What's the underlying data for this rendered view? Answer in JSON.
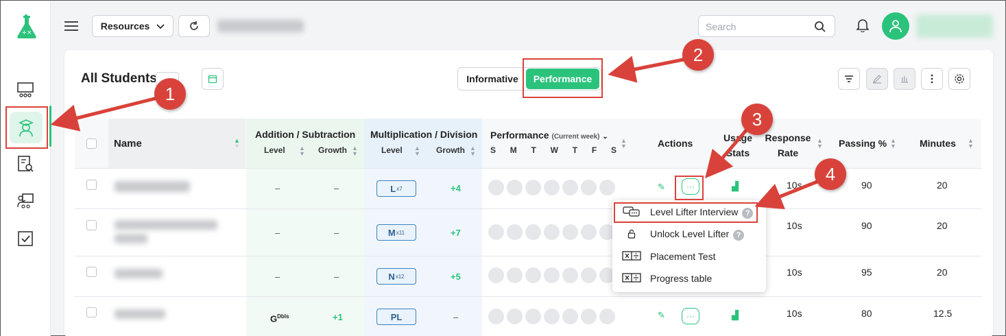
{
  "topbar": {
    "resources_label": "Resources",
    "search_placeholder": "Search"
  },
  "page": {
    "title": "All Students"
  },
  "view_toggle": {
    "informative": "Informative",
    "performance": "Performance"
  },
  "table": {
    "headers": {
      "name": "Name",
      "add_sub": "Addition / Subtraction",
      "mul_div": "Multiplication / Division",
      "level": "Level",
      "growth": "Growth",
      "performance": "Performance",
      "current_week": "(Current week)",
      "days": [
        "S",
        "M",
        "T",
        "W",
        "T",
        "F",
        "S"
      ],
      "actions": "Actions",
      "usage_stats": "Usage Stats",
      "response_rate": "Response Rate",
      "passing": "Passing %",
      "minutes": "Minutes"
    },
    "rows": [
      {
        "add_level": "–",
        "add_growth": "–",
        "mul_level": "L",
        "mul_sup": "x7",
        "mul_growth": "+4",
        "response": "10s",
        "passing": "90",
        "minutes": "20"
      },
      {
        "add_level": "–",
        "add_growth": "–",
        "mul_level": "M",
        "mul_sup": "x11",
        "mul_growth": "+7",
        "response": "10s",
        "passing": "90",
        "minutes": "20"
      },
      {
        "add_level": "–",
        "add_growth": "–",
        "mul_level": "N",
        "mul_sup": "x12",
        "mul_growth": "+5",
        "response": "10s",
        "passing": "95",
        "minutes": "20"
      },
      {
        "add_level": "G",
        "add_sup": "Dbls",
        "add_growth": "+1",
        "mul_level": "PL",
        "mul_sup": "",
        "mul_growth": "–",
        "response": "10s",
        "passing": "80",
        "minutes": "12.5"
      }
    ]
  },
  "menu": {
    "items": [
      {
        "label": "Level Lifter Interview",
        "help": "?"
      },
      {
        "label": "Unlock Level Lifter",
        "help": "?"
      },
      {
        "label": "Placement Test"
      },
      {
        "label": "Progress table"
      }
    ]
  },
  "annotations": {
    "badges": [
      "1",
      "2",
      "3",
      "4"
    ]
  },
  "colors": {
    "accent": "#2bc37c",
    "annotation": "#d9423a"
  }
}
